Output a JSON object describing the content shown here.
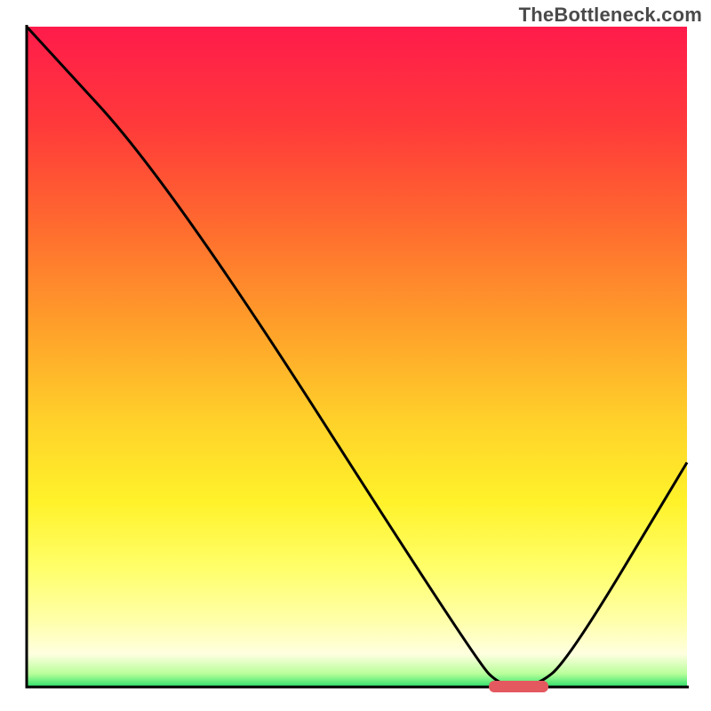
{
  "watermark": "TheBottleneck.com",
  "chart_data": {
    "type": "line",
    "title": "",
    "xlabel": "",
    "ylabel": "",
    "xlim": [
      0,
      100
    ],
    "ylim": [
      0,
      100
    ],
    "x": [
      0,
      22,
      68,
      72,
      77,
      82,
      100
    ],
    "values": [
      100,
      76,
      4,
      0,
      0,
      4,
      34
    ],
    "marker": {
      "x_start": 70,
      "x_end": 79,
      "y": 0,
      "color": "#e4585f"
    },
    "gradient_stops": [
      {
        "offset": 0.0,
        "color": "#ff1b4b"
      },
      {
        "offset": 0.15,
        "color": "#ff3a3a"
      },
      {
        "offset": 0.3,
        "color": "#ff6a2f"
      },
      {
        "offset": 0.45,
        "color": "#ff9e2a"
      },
      {
        "offset": 0.6,
        "color": "#ffd22a"
      },
      {
        "offset": 0.72,
        "color": "#fff22a"
      },
      {
        "offset": 0.82,
        "color": "#ffff6a"
      },
      {
        "offset": 0.9,
        "color": "#ffffaa"
      },
      {
        "offset": 0.95,
        "color": "#ffffe0"
      },
      {
        "offset": 0.98,
        "color": "#b8ff9a"
      },
      {
        "offset": 1.0,
        "color": "#2be06a"
      }
    ],
    "axis_color": "#000000",
    "curve_color": "#000000"
  },
  "plot": {
    "inner_x": 30,
    "inner_y": 30,
    "inner_w": 743,
    "inner_h": 743
  }
}
